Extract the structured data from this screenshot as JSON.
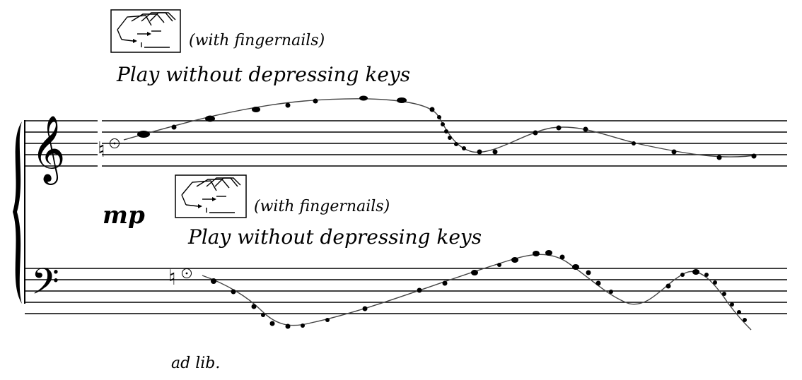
{
  "upper": {
    "technique": "(with fingernails)",
    "instruction": "Play without depressing keys",
    "natural_sign": "♮",
    "clef": "treble"
  },
  "lower": {
    "technique": "(with fingernails)",
    "instruction": "Play without depressing keys",
    "natural_sign": "♮",
    "clef": "bass"
  },
  "dynamic": "mp",
  "tempo_note": "ad lib.",
  "icons": [
    "fingernail-glissando-icon",
    "fingernail-glissando-icon"
  ]
}
